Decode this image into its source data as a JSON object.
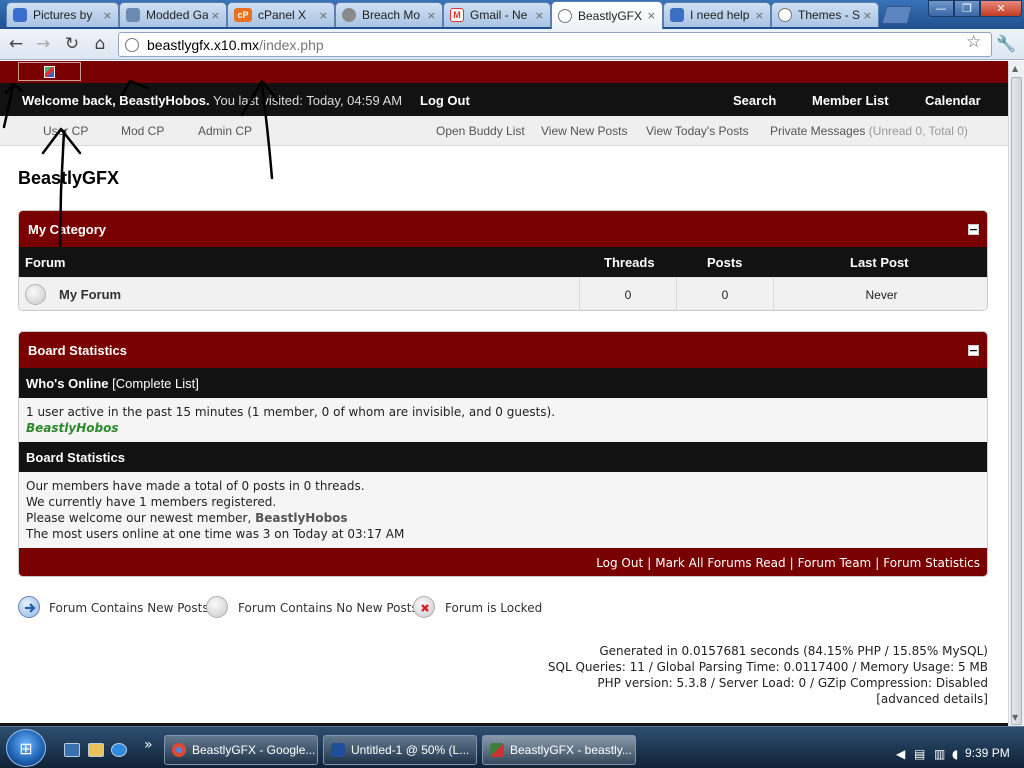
{
  "browser": {
    "tabs": [
      {
        "title": "Pictures by",
        "fav_color": "#3b6fcf",
        "fav_glyph": "",
        "active": false
      },
      {
        "title": "Modded Ga",
        "fav_color": "#6b8bb3",
        "fav_glyph": "",
        "active": false
      },
      {
        "title": "cPanel X",
        "fav_color": "#e8701e",
        "fav_glyph": "cP",
        "active": false
      },
      {
        "title": "Breach Mo",
        "fav_color": "#8a8a8a",
        "fav_glyph": "",
        "active": false
      },
      {
        "title": "Gmail - Ne",
        "fav_color": "#d33",
        "fav_glyph": "M",
        "active": false
      },
      {
        "title": "BeastlyGFX",
        "fav_color": "#8a8a8a",
        "fav_glyph": "",
        "active": true
      },
      {
        "title": "I need help",
        "fav_color": "#3a6fc4",
        "fav_glyph": "",
        "active": false
      },
      {
        "title": "Themes - S",
        "fav_color": "#8a8a8a",
        "fav_glyph": "",
        "active": false
      }
    ],
    "close_glyph": "×",
    "back_icon": "back-arrow-icon",
    "forward_icon": "forward-arrow-icon",
    "reload_icon": "reload-icon",
    "home_icon": "home-icon",
    "url_host": "beastlygfx.x10.mx",
    "url_path": "/index.php",
    "star_icon": "bookmark-star-icon",
    "wrench_icon": "wrench-icon"
  },
  "header": {
    "welcome_bold": "Welcome back, BeastlyHobos.",
    "last_visited": " You last visited: Today, 04:59 AM",
    "logout": "Log Out",
    "links": [
      "Search",
      "Member List",
      "Calendar"
    ],
    "sublinks_left": [
      "User CP",
      "Mod CP",
      "Admin CP"
    ],
    "sublinks_right": [
      "Open Buddy List",
      "View New Posts",
      "View Today's Posts"
    ],
    "pm_label": "Private Messages",
    "pm_counts": " (Unread 0, Total 0)"
  },
  "board_title": "BeastlyGFX",
  "category": {
    "title": "My Category",
    "collapse_glyph": "−",
    "columns": {
      "forum": "Forum",
      "threads": "Threads",
      "posts": "Posts",
      "last_post": "Last Post"
    },
    "forums": [
      {
        "name": "My Forum",
        "threads": "0",
        "posts": "0",
        "last_post": "Never"
      }
    ]
  },
  "stats": {
    "title": "Board Statistics",
    "collapse_glyph": "−",
    "whos_online_label": "Who's Online",
    "complete_list": " [Complete List]",
    "online_text": "1 user active in the past 15 minutes (1 member, 0 of whom are invisible, and 0 guests).",
    "online_user": "BeastlyHobos",
    "board_stats_label": "Board Statistics",
    "line1": "Our members have made a total of 0 posts in 0 threads.",
    "line2": "We currently have 1 members registered.",
    "line3_prefix": "Please welcome our newest member, ",
    "newest_member": "BeastlyHobos",
    "line4": "The most users online at one time was 3 on Today at 03:17 AM",
    "footer_links": [
      "Log Out",
      "Mark All Forums Read",
      "Forum Team",
      "Forum Statistics"
    ],
    "footer_sep": "|"
  },
  "legend": [
    {
      "text": "Forum Contains New Posts",
      "icon": "new-posts-icon"
    },
    {
      "text": "Forum Contains No New Posts",
      "icon": "no-new-posts-icon"
    },
    {
      "text": "Forum is Locked",
      "icon": "locked-forum-icon"
    }
  ],
  "debug": {
    "line1": "Generated in 0.0157681 seconds (84.15% PHP / 15.85% MySQL)",
    "line2": "SQL Queries: 11 / Global Parsing Time: 0.0117400 / Memory Usage: 5 MB",
    "line3": "PHP version: 5.3.8 / Server Load: 0 / GZip Compression: Disabled",
    "line4": "[advanced details]"
  },
  "taskbar": {
    "start_icon": "windows-start-icon",
    "quick_launch": [
      "show-desktop-icon",
      "explorer-icon",
      "ie-icon"
    ],
    "more_glyph": "»",
    "buttons": [
      {
        "label": "BeastlyGFX - Google...",
        "icon_color": "#e04a2f",
        "active": false
      },
      {
        "label": "Untitled-1 @ 50% (L...",
        "icon_color": "#1f4f9c",
        "active": false
      },
      {
        "label": "BeastlyGFX - beastly...",
        "icon_color": "#3b7f3b",
        "active": true
      }
    ],
    "clock": "9:39 PM"
  },
  "colors": {
    "maroon": "#780000",
    "black_bar": "#121212",
    "online_green": "#2a8a2a"
  }
}
